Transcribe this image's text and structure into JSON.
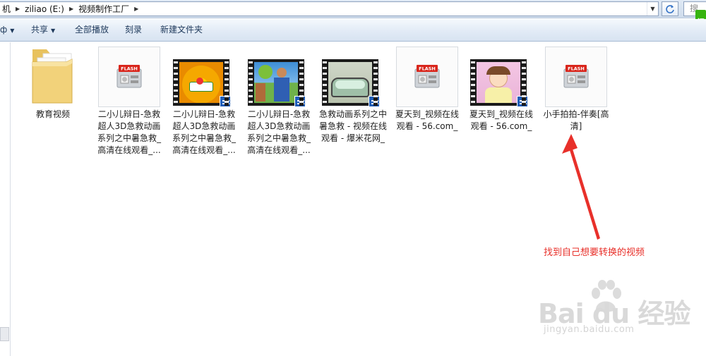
{
  "address_bar": {
    "crumbs": [
      "机",
      "ziliao (E:)",
      "视频制作工厂"
    ],
    "search_placeholder": "搜"
  },
  "toolbar": {
    "organize_label": "ф",
    "share_label": "共享",
    "playall_label": "全部播放",
    "burn_label": "刻录",
    "newfolder_label": "新建文件夹"
  },
  "files": [
    {
      "name": "教育视频",
      "type": "folder"
    },
    {
      "name": "二小儿辩日-急救超人3D急救动画系列之中暑急救_高清在线观看_...",
      "type": "flash"
    },
    {
      "name": "二小儿辩日-急救超人3D急救动画系列之中暑急救_高清在线观看_...",
      "type": "video"
    },
    {
      "name": "二小儿辩日-急救超人3D急救动画系列之中暑急救_高清在线观看_...",
      "type": "video"
    },
    {
      "name": "急救动画系列之中暑急救 - 视频在线观看 - 爆米花网_",
      "type": "video"
    },
    {
      "name": "夏天到_视频在线观看 - 56.com_",
      "type": "flash"
    },
    {
      "name": "夏天到_视频在线观看 - 56.com_",
      "type": "video"
    },
    {
      "name": "小手拍拍-伴奏[高清]",
      "type": "flash"
    }
  ],
  "flash_badge": "FLASH",
  "annotation": "找到自己想要转换的视频",
  "watermark": {
    "main": "Bai du 经验",
    "sub": "jingyan.baidu.com"
  },
  "side_icon": "经",
  "colors": {
    "annotation": "#e8302a",
    "toolbar_text": "#1e395b",
    "film_badge": "#1e5db8"
  }
}
